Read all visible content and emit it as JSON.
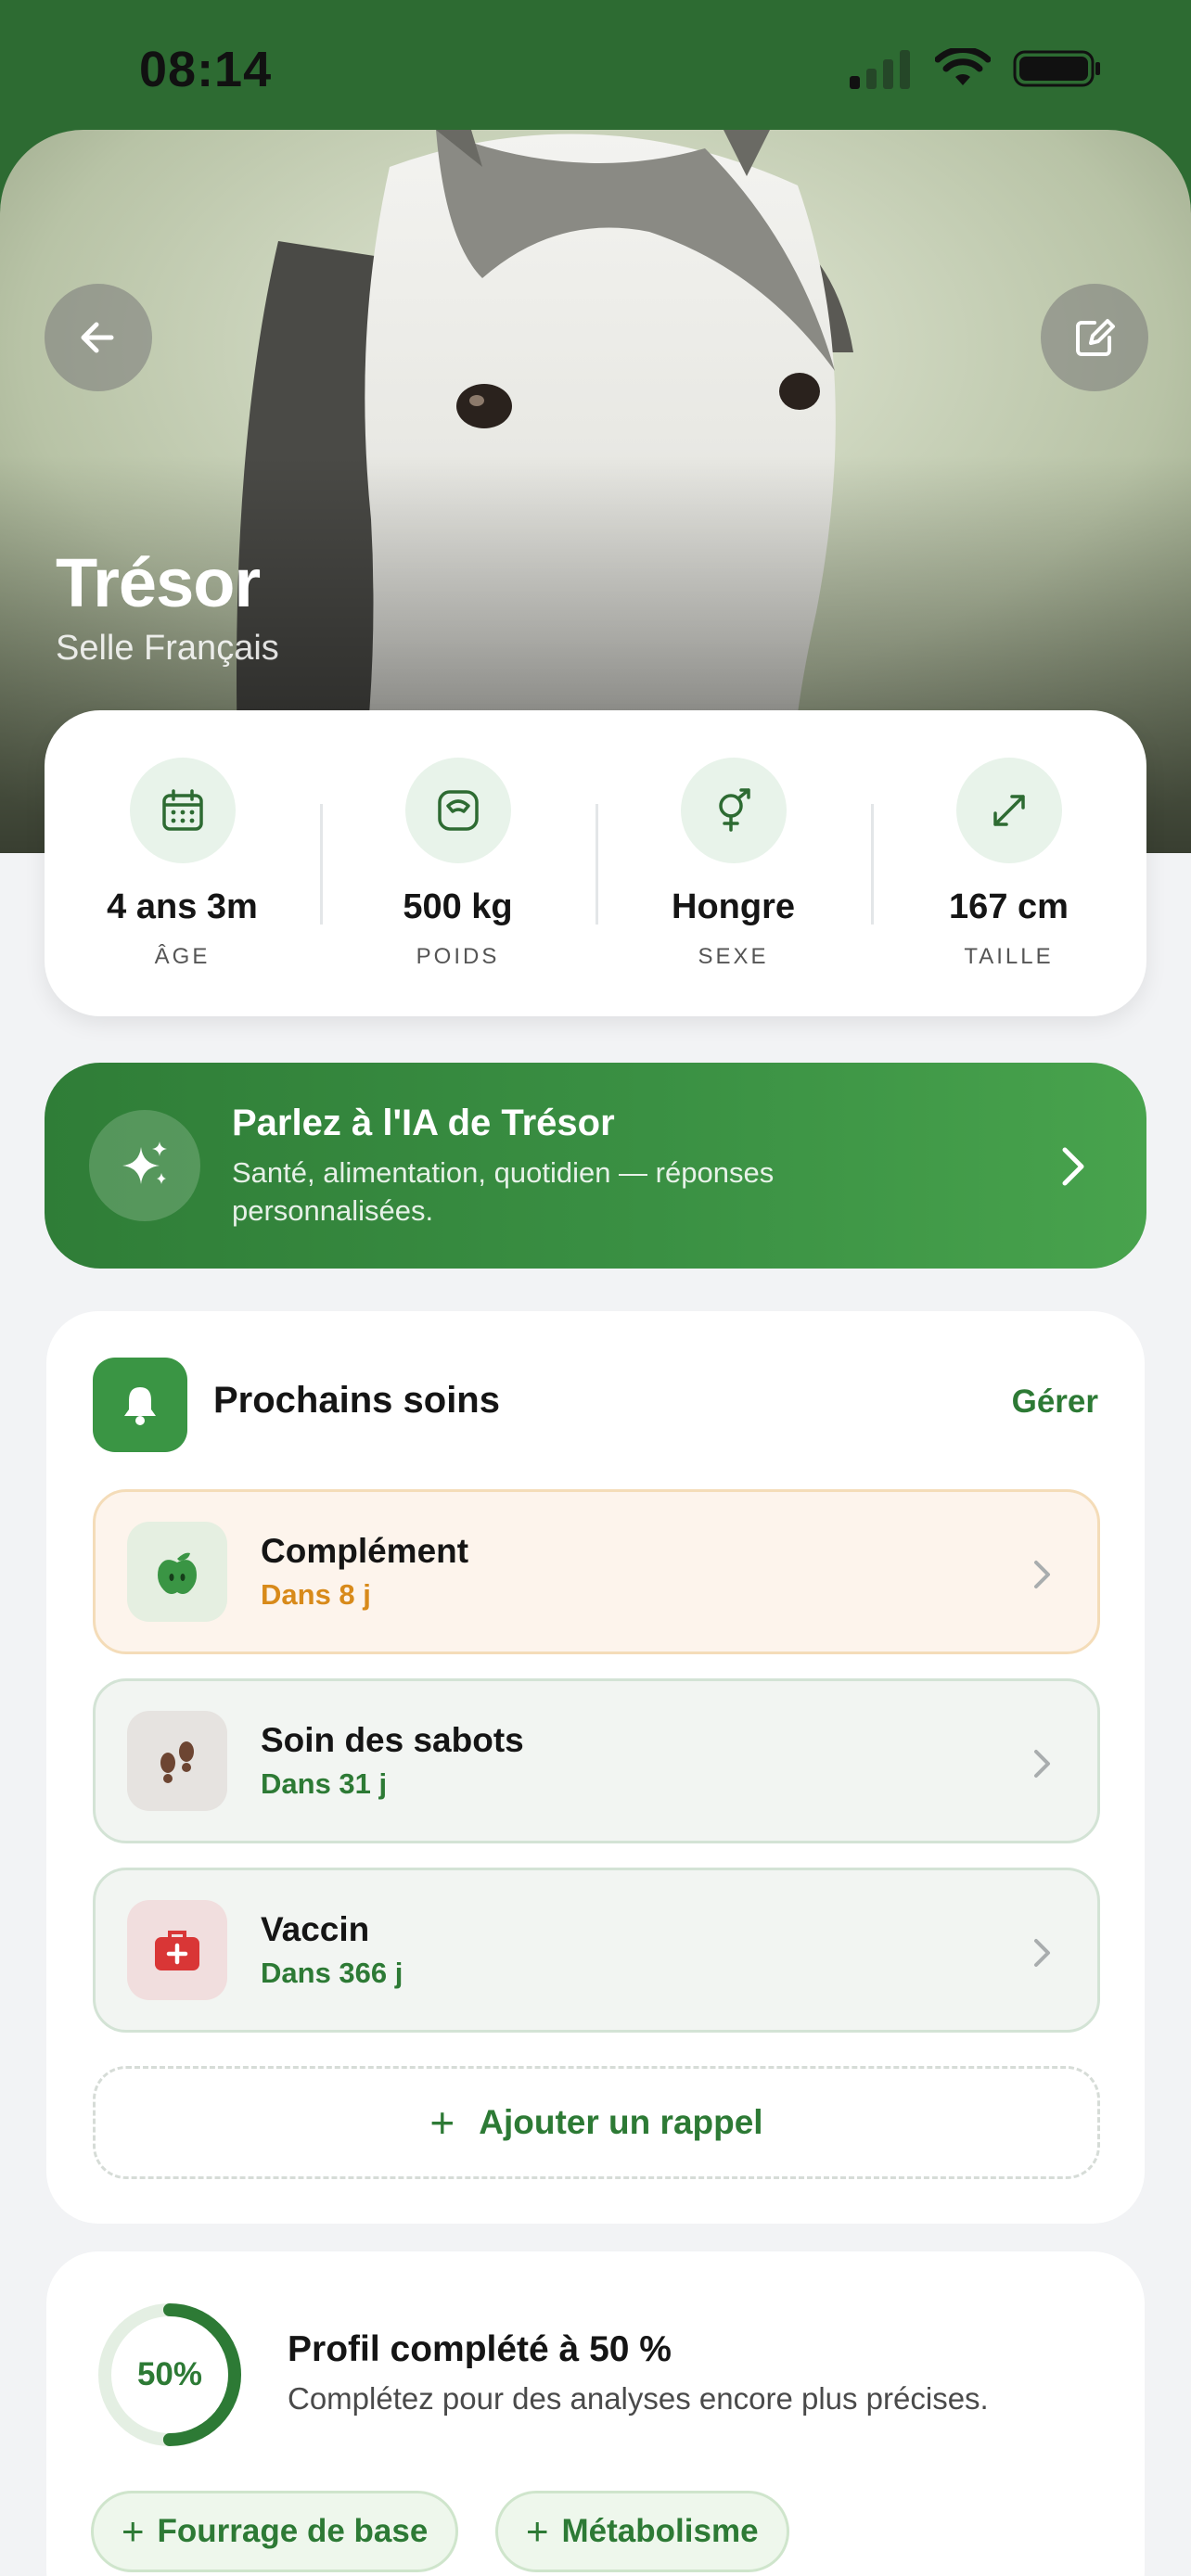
{
  "status_bar": {
    "time": "08:14"
  },
  "horse": {
    "name": "Trésor",
    "breed": "Selle Français"
  },
  "stats": [
    {
      "icon": "calendar-icon",
      "value": "4 ans 3m",
      "label": "ÂGE"
    },
    {
      "icon": "scale-icon",
      "value": "500 kg",
      "label": "POIDS"
    },
    {
      "icon": "gender-icon",
      "value": "Hongre",
      "label": "SEXE"
    },
    {
      "icon": "expand-arrows-icon",
      "value": "167 cm",
      "label": "TAILLE"
    }
  ],
  "ai_banner": {
    "title": "Parlez à l'IA de Trésor",
    "subtitle": "Santé, alimentation, quotidien — réponses personnalisées."
  },
  "soins": {
    "title": "Prochains soins",
    "manage_label": "Gérer",
    "items": [
      {
        "name": "Complément",
        "due": "Dans 8 j",
        "icon": "apple-icon",
        "due_color": "#d88a1a"
      },
      {
        "name": "Soin des sabots",
        "due": "Dans 31 j",
        "icon": "hoof-prints-icon",
        "due_color": "#2d7a35"
      },
      {
        "name": "Vaccin",
        "due": "Dans 366 j",
        "icon": "first-aid-kit-icon",
        "due_color": "#2d7a35"
      }
    ],
    "add_label": "Ajouter un rappel"
  },
  "profile": {
    "progress_percent": 50,
    "progress_label": "50%",
    "title": "Profil complété à 50 %",
    "subtitle": "Complétez pour des analyses encore plus précises.",
    "chips": [
      "Fourrage de base",
      "Métabolisme"
    ]
  },
  "colors": {
    "brand_green": "#2d7a35",
    "warning_orange": "#d88a1a"
  }
}
